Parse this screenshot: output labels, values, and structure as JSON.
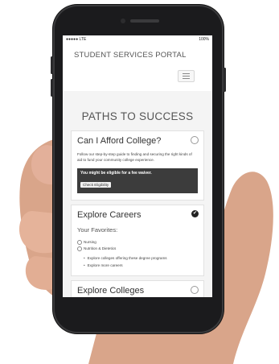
{
  "status_bar": {
    "carrier": "●●●●● LTE",
    "time": "",
    "battery": "100%"
  },
  "portal": {
    "title": "STUDENT SERVICES PORTAL"
  },
  "main": {
    "heading": "PATHS TO SUCCESS",
    "cards": [
      {
        "title": "Can I Afford College?",
        "text": "Follow our step-by-step guide to finding and securing the right kinds of aid to fund your community college experience.",
        "waiver_text": "You might be eligible for a fee waiver.",
        "button_label": "Check Eligibility"
      },
      {
        "title": "Explore Careers",
        "favorites_label": "Your Favorites:",
        "favorites": [
          "Nursing",
          "Nutrition & Dietetics"
        ],
        "links": [
          "Explore colleges offering these degree programs",
          "Explore more careers"
        ]
      },
      {
        "title": "Explore Colleges"
      }
    ]
  }
}
